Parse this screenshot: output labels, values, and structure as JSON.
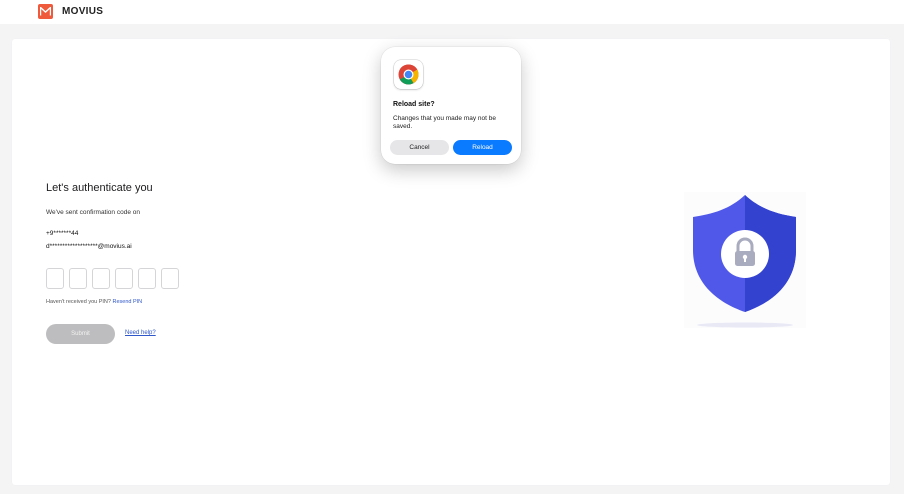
{
  "header": {
    "brand": "MOVIUS",
    "logo_icon": "movius-m-logo",
    "brand_color": "#f05a3c"
  },
  "auth": {
    "title": "Let's authenticate you",
    "sent_text": "We've sent confirmation code on",
    "phone": "+9*******44",
    "email": "d*******************@movius.ai",
    "pin_boxes": [
      "",
      "",
      "",
      "",
      "",
      ""
    ],
    "resend_prefix": "Haven't received you PIN?",
    "resend_link": "Resend PIN",
    "submit_label": "Submit",
    "need_help": "Need help?",
    "illustration": "shield-lock-icon"
  },
  "dialog": {
    "app_icon": "chrome-icon",
    "title": "Reload site?",
    "message": "Changes that you made may not be saved.",
    "cancel_label": "Cancel",
    "reload_label": "Reload",
    "accent_color": "#0a7aff"
  }
}
